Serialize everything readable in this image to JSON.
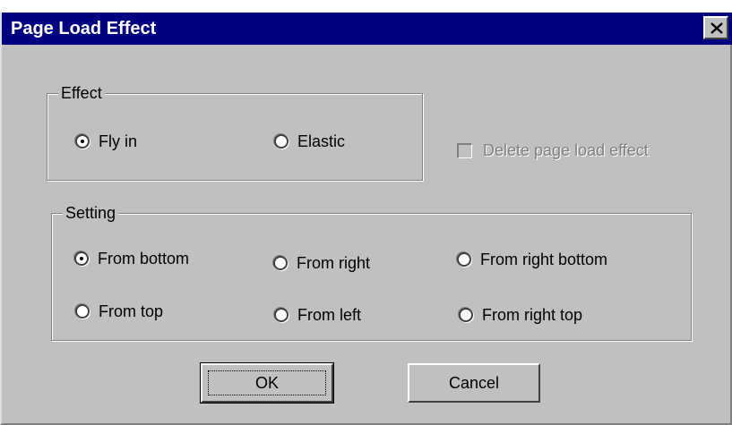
{
  "dialog": {
    "title": "Page Load Effect",
    "close_icon": "close-x-icon"
  },
  "effect_group": {
    "label": "Effect",
    "options": [
      {
        "label": "Fly in",
        "checked": true
      },
      {
        "label": "Elastic",
        "checked": false
      }
    ]
  },
  "delete_checkbox": {
    "label": "Delete page load effect",
    "checked": false,
    "enabled": false
  },
  "setting_group": {
    "label": "Setting",
    "options": [
      {
        "label": "From bottom",
        "checked": true
      },
      {
        "label": "From right",
        "checked": false
      },
      {
        "label": "From right bottom",
        "checked": false
      },
      {
        "label": "From top",
        "checked": false
      },
      {
        "label": "From left",
        "checked": false
      },
      {
        "label": "From right top",
        "checked": false
      }
    ]
  },
  "buttons": {
    "ok_label": "OK",
    "cancel_label": "Cancel"
  },
  "colors": {
    "title_bar": "#000080",
    "dialog_face": "#c0c0c0",
    "disabled_text": "#808080"
  }
}
